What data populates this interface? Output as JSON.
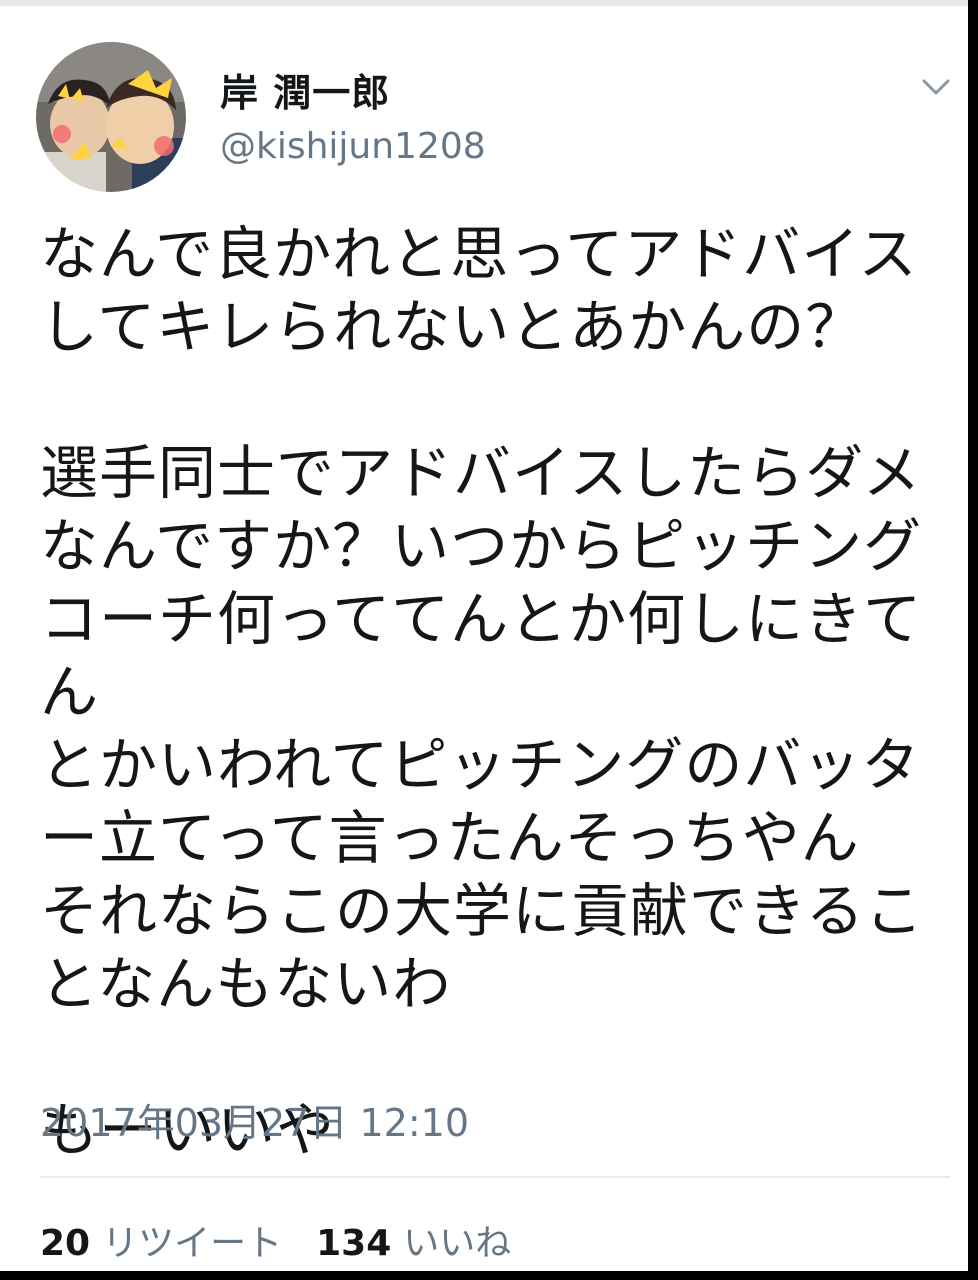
{
  "profile": {
    "display_name": "岸 潤一郎",
    "handle": "@kishijun1208"
  },
  "icons": {
    "avatar": "avatar",
    "menu": "chevron-down-icon"
  },
  "tweet": {
    "paragraphs": [
      "なんで良かれと思ってアドバイス\nしてキレられないとあかんの？",
      "選手同士でアドバイスしたらダメ\nなんですか？いつからピッチング\nコーチ何っててんとか何しにきてん\nとかいわれてピッチングのバッタ\nー立てって言ったんそっちやん\nそれならこの大学に貢献できるこ\nとなんもないわ",
      "もーいいや"
    ],
    "timestamp": "2017年03月27日 12:10"
  },
  "stats": {
    "retweet_count": "20",
    "retweet_label": "リツイート",
    "like_count": "134",
    "like_label": "いいね"
  },
  "colors": {
    "text": "#14171a",
    "muted": "#657786",
    "divider": "#e6ecf0",
    "frame": "#000000"
  }
}
